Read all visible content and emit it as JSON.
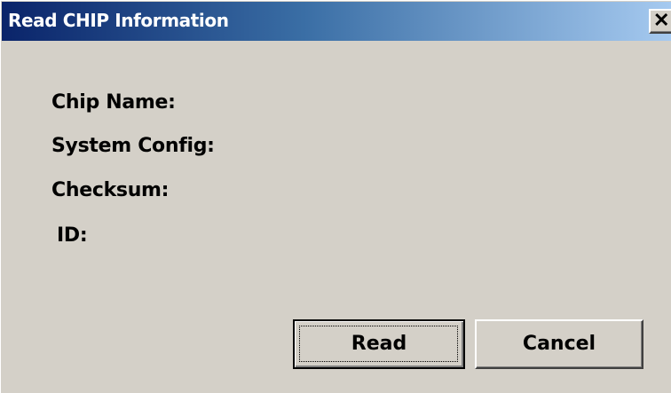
{
  "window": {
    "title": "Read CHIP Information",
    "close_glyph": "✕"
  },
  "fields": {
    "chip_name_label": "Chip Name:",
    "system_config_label": "System Config:",
    "checksum_label": "Checksum:",
    "id_label": "ID:"
  },
  "buttons": {
    "read_label": "Read",
    "cancel_label": "Cancel"
  },
  "colors": {
    "titlebar_start": "#0a246a",
    "titlebar_end": "#a6caf0",
    "face": "#d4d0c8"
  }
}
